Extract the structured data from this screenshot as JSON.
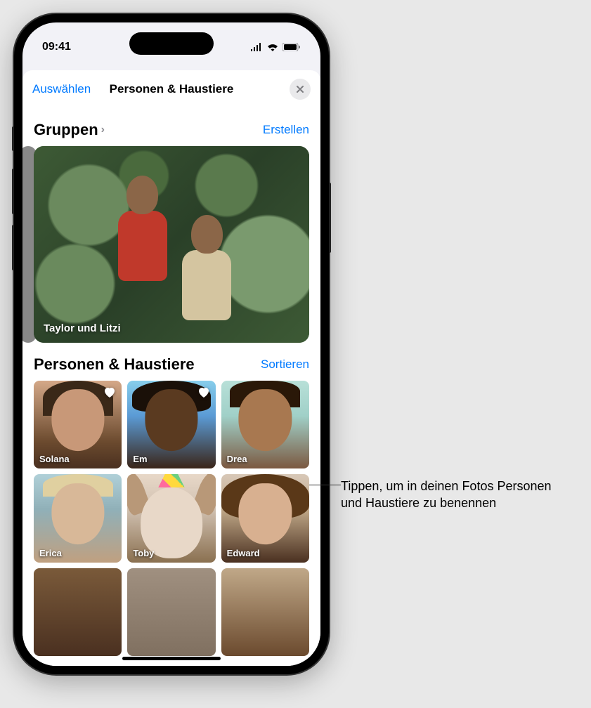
{
  "status_bar": {
    "time": "09:41"
  },
  "nav": {
    "select_label": "Auswählen",
    "title": "Personen & Haustiere"
  },
  "groups_section": {
    "title": "Gruppen",
    "action_label": "Erstellen",
    "card_label": "Taylor und Litzi"
  },
  "people_section": {
    "title": "Personen & Haustiere",
    "action_label": "Sortieren",
    "people": [
      {
        "name": "Solana",
        "favorite": true
      },
      {
        "name": "Em",
        "favorite": true
      },
      {
        "name": "Drea",
        "favorite": false
      },
      {
        "name": "Erica",
        "favorite": false
      },
      {
        "name": "Toby",
        "favorite": false
      },
      {
        "name": "Edward",
        "favorite": false
      }
    ]
  },
  "callout": {
    "text": "Tippen, um in deinen Fotos Personen und Haustiere zu benennen"
  }
}
